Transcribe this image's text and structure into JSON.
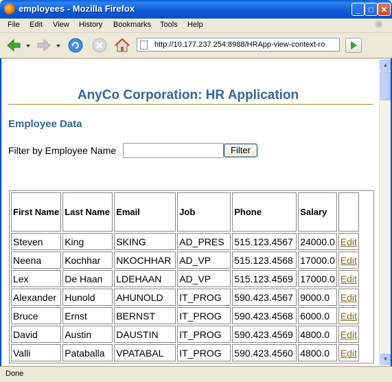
{
  "window": {
    "title": "employees - Mozilla Firefox",
    "minimize": "_",
    "maximize": "□",
    "close": "✕"
  },
  "menu": [
    "File",
    "Edit",
    "View",
    "History",
    "Bookmarks",
    "Tools",
    "Help"
  ],
  "nav": {
    "url": "http://10.177.237.254:8988/HRApp-view-context-ro"
  },
  "page": {
    "heading": "AnyCo Corporation: HR Application",
    "subheading": "Employee Data",
    "filter_label": "Filter by Employee Name",
    "filter_value": "",
    "filter_button": "Filter"
  },
  "table": {
    "headers": [
      "First Name",
      "Last Name",
      "Email",
      "Job",
      "Phone",
      "Salary",
      ""
    ],
    "rows": [
      [
        "Steven",
        "King",
        "SKING",
        "AD_PRES",
        "515.123.4567",
        "24000.0",
        "Edit"
      ],
      [
        "Neena",
        "Kochhar",
        "NKOCHHAR",
        "AD_VP",
        "515.123.4568",
        "17000.0",
        "Edit"
      ],
      [
        "Lex",
        "De Haan",
        "LDEHAAN",
        "AD_VP",
        "515.123.4569",
        "17000.0",
        "Edit"
      ],
      [
        "Alexander",
        "Hunold",
        "AHUNOLD",
        "IT_PROG",
        "590.423.4567",
        "9000.0",
        "Edit"
      ],
      [
        "Bruce",
        "Ernst",
        "BERNST",
        "IT_PROG",
        "590.423.4568",
        "6000.0",
        "Edit"
      ],
      [
        "David",
        "Austin",
        "DAUSTIN",
        "IT_PROG",
        "590.423.4569",
        "4800.0",
        "Edit"
      ],
      [
        "Valli",
        "Pataballa",
        "VPATABAL",
        "IT_PROG",
        "590.423.4560",
        "4800.0",
        "Edit"
      ]
    ]
  },
  "status": {
    "text": "Done"
  },
  "colors": {
    "heading": "#336699",
    "link": "#8a6a1e",
    "titlebar": "#0a5fd8"
  }
}
